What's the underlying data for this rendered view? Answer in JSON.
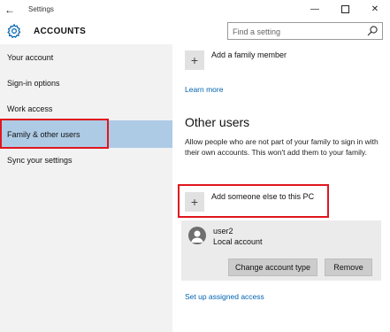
{
  "window": {
    "title": "Settings",
    "back_icon": "back-arrow-icon",
    "controls": [
      "minimize-icon",
      "maximize-icon",
      "close-icon"
    ]
  },
  "header": {
    "heading": "ACCOUNTS",
    "icon": "gear-icon",
    "search_placeholder": "Find a setting",
    "search_icon": "search-icon"
  },
  "sidebar": {
    "items": [
      {
        "label": "Your account"
      },
      {
        "label": "Sign-in options"
      },
      {
        "label": "Work access"
      },
      {
        "label": "Family & other users",
        "selected": true
      },
      {
        "label": "Sync your settings"
      }
    ]
  },
  "content": {
    "add_family_label": "Add a family member",
    "learn_more": "Learn more",
    "other_users_title": "Other users",
    "other_users_desc": "Allow people who are not part of your family to sign in with their own accounts. This won't add them to your family.",
    "add_someone_label": "Add someone else to this PC",
    "user": {
      "name": "user2",
      "type": "Local account",
      "change_type_label": "Change account type",
      "remove_label": "Remove"
    },
    "assigned_access_link": "Set up assigned access"
  },
  "colors": {
    "accent": "#0063b1",
    "selection": "#aecbe5",
    "highlight_box": "#e0161e",
    "sidebar_bg": "#f2f2f2"
  }
}
